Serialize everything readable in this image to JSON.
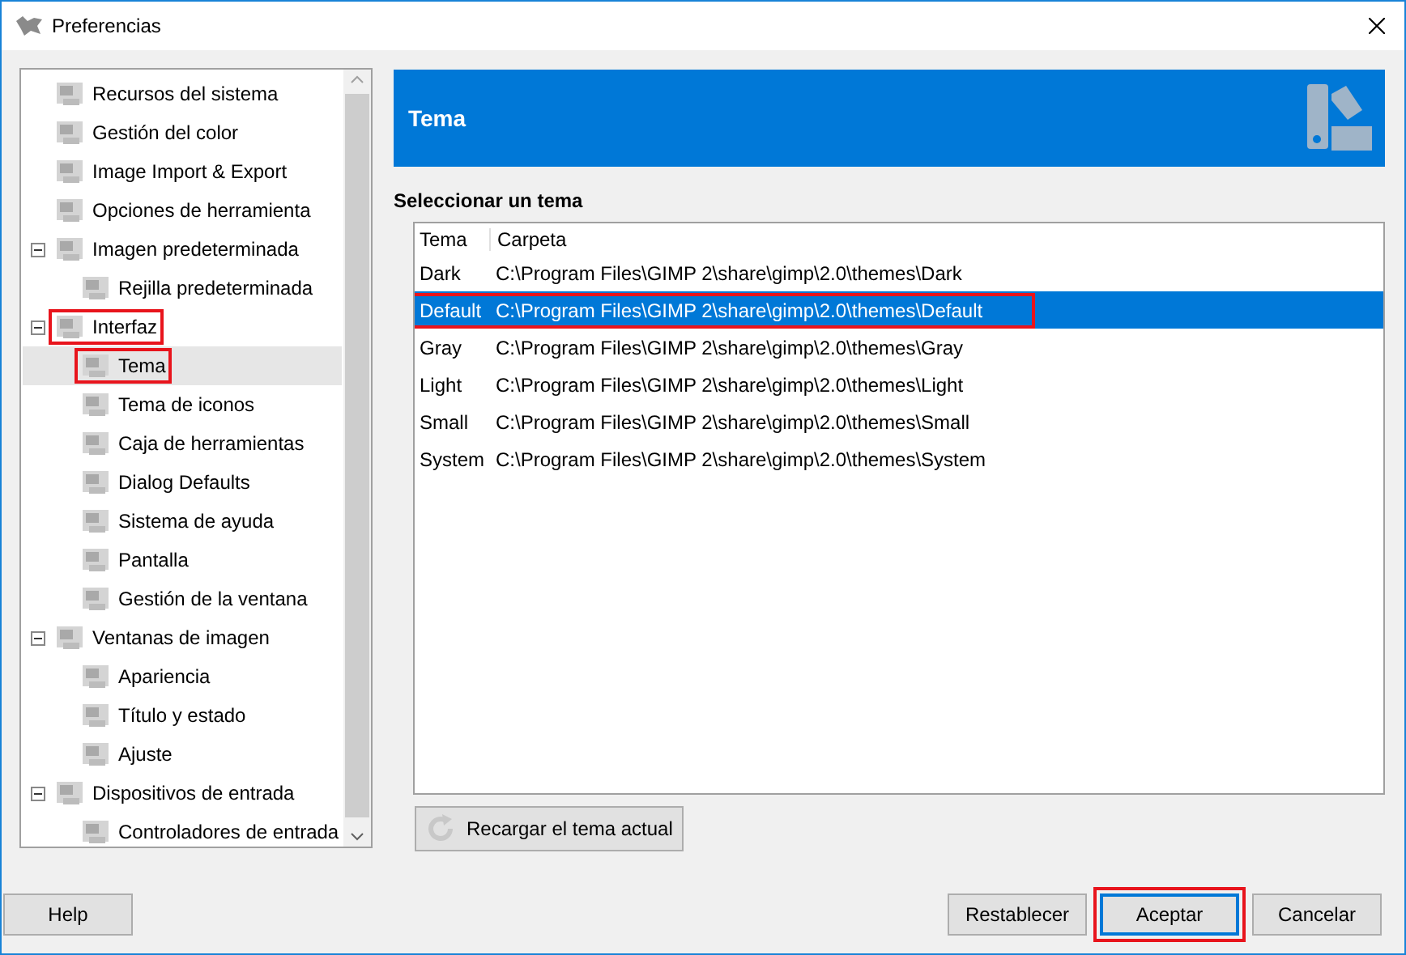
{
  "window": {
    "title": "Preferencias"
  },
  "sidebar": {
    "items": [
      {
        "label": "Recursos del sistema",
        "selected": false,
        "highlighted": false
      },
      {
        "label": "Gestión del color",
        "selected": false,
        "highlighted": false
      },
      {
        "label": "Image Import & Export",
        "selected": false,
        "highlighted": false
      },
      {
        "label": "Opciones de herramienta",
        "selected": false,
        "highlighted": false
      },
      {
        "label": "Imagen predeterminada",
        "selected": false,
        "highlighted": false,
        "expanded": true,
        "children": [
          {
            "label": "Rejilla predeterminada",
            "selected": false,
            "highlighted": false
          }
        ]
      },
      {
        "label": "Interfaz",
        "selected": false,
        "highlighted": true,
        "expanded": true,
        "children": [
          {
            "label": "Tema",
            "selected": true,
            "highlighted": true
          },
          {
            "label": "Tema de iconos",
            "selected": false,
            "highlighted": false
          },
          {
            "label": "Caja de herramientas",
            "selected": false,
            "highlighted": false
          },
          {
            "label": "Dialog Defaults",
            "selected": false,
            "highlighted": false
          },
          {
            "label": "Sistema de ayuda",
            "selected": false,
            "highlighted": false
          },
          {
            "label": "Pantalla",
            "selected": false,
            "highlighted": false
          },
          {
            "label": "Gestión de la ventana",
            "selected": false,
            "highlighted": false
          }
        ]
      },
      {
        "label": "Ventanas de imagen",
        "selected": false,
        "highlighted": false,
        "expanded": true,
        "children": [
          {
            "label": "Apariencia",
            "selected": false,
            "highlighted": false
          },
          {
            "label": "Título y estado",
            "selected": false,
            "highlighted": false
          },
          {
            "label": "Ajuste",
            "selected": false,
            "highlighted": false
          }
        ]
      },
      {
        "label": "Dispositivos de entrada",
        "selected": false,
        "highlighted": false,
        "expanded": true,
        "children": [
          {
            "label": "Controladores de entrada",
            "selected": false,
            "highlighted": false
          }
        ]
      }
    ]
  },
  "panel": {
    "title": "Tema",
    "section_label": "Seleccionar un tema",
    "table": {
      "columns": [
        "Tema",
        "Carpeta"
      ],
      "rows": [
        {
          "cells": [
            "Dark",
            "C:\\Program Files\\GIMP 2\\share\\gimp\\2.0\\themes\\Dark"
          ],
          "selected": false,
          "highlighted": false
        },
        {
          "cells": [
            "Default",
            "C:\\Program Files\\GIMP 2\\share\\gimp\\2.0\\themes\\Default"
          ],
          "selected": true,
          "highlighted": true
        },
        {
          "cells": [
            "Gray",
            "C:\\Program Files\\GIMP 2\\share\\gimp\\2.0\\themes\\Gray"
          ],
          "selected": false,
          "highlighted": false
        },
        {
          "cells": [
            "Light",
            "C:\\Program Files\\GIMP 2\\share\\gimp\\2.0\\themes\\Light"
          ],
          "selected": false,
          "highlighted": false
        },
        {
          "cells": [
            "Small",
            "C:\\Program Files\\GIMP 2\\share\\gimp\\2.0\\themes\\Small"
          ],
          "selected": false,
          "highlighted": false
        },
        {
          "cells": [
            "System",
            "C:\\Program Files\\GIMP 2\\share\\gimp\\2.0\\themes\\System"
          ],
          "selected": false,
          "highlighted": false
        }
      ]
    },
    "reload_button": "Recargar el tema actual"
  },
  "footer": {
    "buttons": [
      {
        "label": "Help",
        "default": false,
        "highlighted": false
      },
      {
        "label": "Restablecer",
        "default": false,
        "highlighted": false
      },
      {
        "label": "Aceptar",
        "default": true,
        "highlighted": true
      },
      {
        "label": "Cancelar",
        "default": false,
        "highlighted": false
      }
    ]
  }
}
